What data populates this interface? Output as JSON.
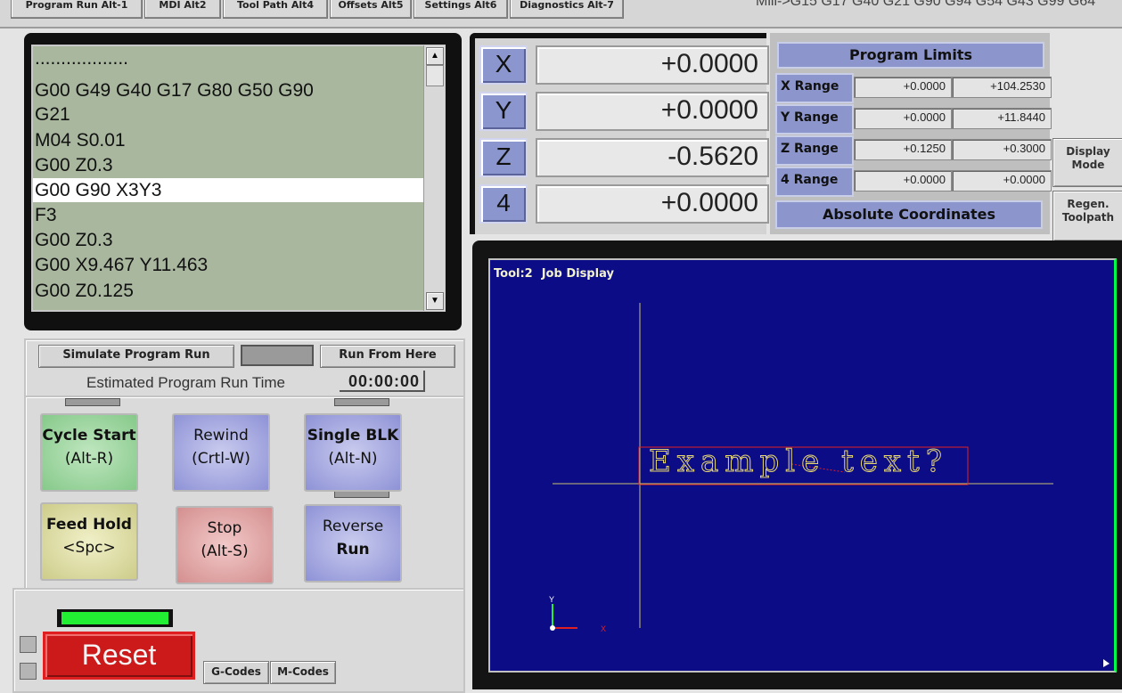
{
  "tabs": [
    {
      "label": "Program Run Alt-1"
    },
    {
      "label": "MDI Alt2"
    },
    {
      "label": "Tool Path Alt4"
    },
    {
      "label": "Offsets Alt5"
    },
    {
      "label": "Settings Alt6"
    },
    {
      "label": "Diagnostics Alt-7"
    }
  ],
  "modal_line": "Mill->G15  G17 G40 G21 G90 G94 G54 G43 G99 G64",
  "gcode": {
    "lines": [
      "..................",
      "G00 G49 G40  G17 G80 G50 G90",
      "G21",
      "M04 S0.01",
      "G00 Z0.3",
      "G00 G90 X3Y3",
      "F3",
      "G00 Z0.3",
      "G00 X9.467 Y11.463",
      "G00 Z0.125"
    ],
    "scroll_up": "▲",
    "scroll_down": "▼"
  },
  "dro": {
    "axes": [
      {
        "label": "X",
        "value": "+0.0000"
      },
      {
        "label": "Y",
        "value": "+0.0000"
      },
      {
        "label": "Z",
        "value": "-0.5620"
      },
      {
        "label": "4",
        "value": "+0.0000"
      }
    ]
  },
  "limits": {
    "title": "Program Limits",
    "rows": [
      {
        "label": "X Range",
        "min": "+0.0000",
        "max": "+104.2530"
      },
      {
        "label": "Y Range",
        "min": "+0.0000",
        "max": "+11.8440"
      },
      {
        "label": "Z Range",
        "min": "+0.1250",
        "max": "+0.3000"
      },
      {
        "label": "4 Range",
        "min": "+0.0000",
        "max": "+0.0000"
      }
    ],
    "mode": "Absolute Coordinates",
    "display_mode": "Display Mode",
    "regen": "Regen. Toolpath"
  },
  "simulate": {
    "simulate_label": "Simulate Program Run",
    "run_from_here_label": "Run From Here",
    "est_label": "Estimated Program Run Time",
    "est_value": "00:00:00"
  },
  "controls": {
    "cycle_start": {
      "l1": "Cycle Start",
      "l2": "(Alt-R)"
    },
    "rewind": {
      "l1": "Rewind",
      "l2": "(Crtl-W)"
    },
    "single_blk": {
      "l1": "Single BLK",
      "l2": "(Alt-N)"
    },
    "feed_hold": {
      "l1": "Feed Hold",
      "l2": "<Spc>"
    },
    "stop": {
      "l1": "Stop",
      "l2": "(Alt-S)"
    },
    "reverse_run": {
      "l1": "Reverse",
      "l2": "Run"
    }
  },
  "reset": {
    "label": "Reset",
    "gcodes": "G-Codes",
    "mcodes": "M-Codes"
  },
  "toolpath": {
    "tool": "Tool:2",
    "title": "Job Display",
    "text": "Example text?",
    "axis_y": "Y",
    "axis_x": "X"
  },
  "colors": {
    "toolpath_bg": "#0c0c86",
    "reset_red": "#cc1a1a",
    "status_green": "#22ee33",
    "axis_blue": "#8a96cd"
  }
}
